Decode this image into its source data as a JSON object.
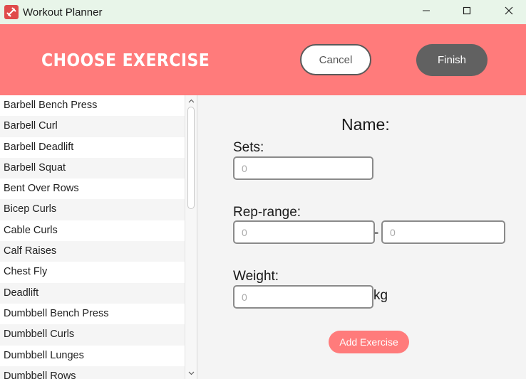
{
  "window": {
    "title": "Workout Planner",
    "app_icon": "dumbbell-icon",
    "controls": [
      "minimize-icon",
      "maximize-icon",
      "close-icon"
    ]
  },
  "header": {
    "title": "CHOOSE EXERCISE",
    "cancel_label": "Cancel",
    "finish_label": "Finish",
    "background_color": "#ff7b7b",
    "finish_color": "#616161"
  },
  "exercise_list": {
    "items": [
      "Barbell Bench Press",
      "Barbell Curl",
      "Barbell Deadlift",
      "Barbell Squat",
      "Bent Over Rows",
      "Bicep Curls",
      "Cable Curls",
      "Calf Raises",
      "Chest Fly",
      "Deadlift",
      "Dumbbell Bench Press",
      "Dumbbell Curls",
      "Dumbbell Lunges",
      "Dumbbell Rows"
    ]
  },
  "form": {
    "name_label": "Name:",
    "sets_label": "Sets:",
    "sets_placeholder": "0",
    "rep_range_label": "Rep-range:",
    "rep_min_placeholder": "0",
    "rep_separator": "-",
    "rep_max_placeholder": "0",
    "weight_label": "Weight:",
    "weight_placeholder": "0",
    "weight_unit": "kg",
    "add_button_label": "Add Exercise",
    "accent_color": "#ff7b7b"
  }
}
